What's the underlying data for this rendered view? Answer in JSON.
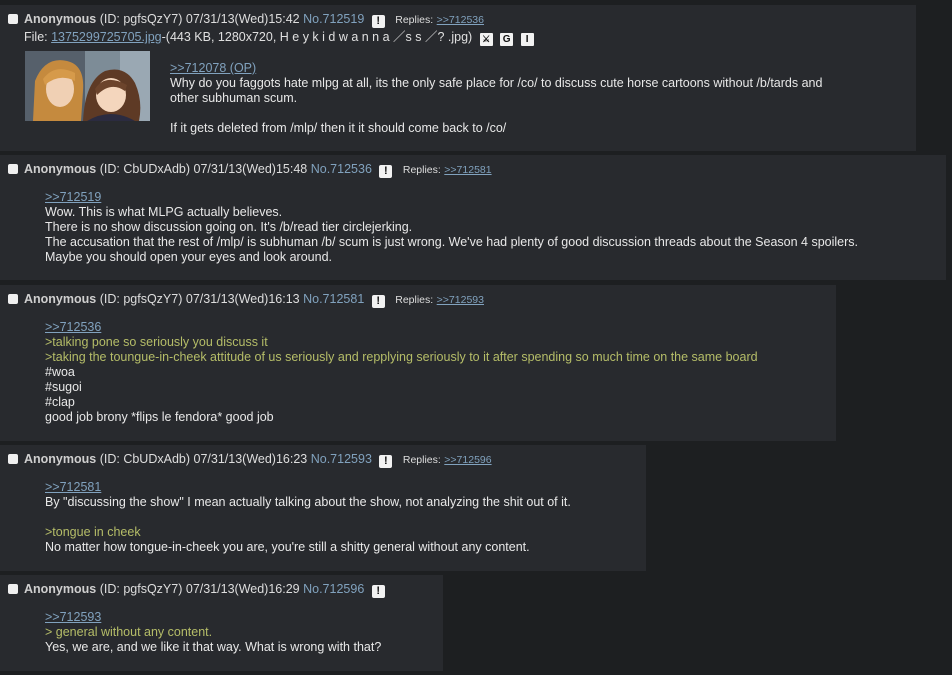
{
  "posts": [
    {
      "name": "Anonymous",
      "id": "(ID: pgfsQzY7)",
      "date": "07/31/13(Wed)15:42",
      "no": "No.712519",
      "replies_label": "Replies:",
      "replies": [
        ">>712536"
      ],
      "file_label": "File:",
      "file_name": "1375299725705.jpg",
      "file_info": "-(443 KB, 1280x720, H e y  k i d  w a n n a ／s s ／? .jpg)",
      "file_icons": [
        "search-icon",
        "google-icon",
        "iqdb-icon"
      ],
      "lines": [
        {
          "quote": ">>712078 (OP)"
        },
        {
          "text": "Why do you faggots hate mlpg at all, its the only safe place for /co/ to discuss cute horse cartoons without /b/tards and"
        },
        {
          "text": "other subhuman scum."
        },
        {
          "text": ""
        },
        {
          "text": "If it gets deleted from /mlp/ then it it should come back to /co/"
        }
      ]
    },
    {
      "name": "Anonymous",
      "id": "(ID: CbUDxAdb)",
      "date": "07/31/13(Wed)15:48",
      "no": "No.712536",
      "replies_label": "Replies:",
      "replies": [
        ">>712581"
      ],
      "lines": [
        {
          "quote": ">>712519"
        },
        {
          "text": "Wow. This is what MLPG actually believes."
        },
        {
          "text": "There is no show discussion going on. It's /b/read tier circlejerking."
        },
        {
          "text": "The accusation that the rest of /mlp/ is subhuman /b/ scum is just wrong. We've had plenty of good discussion threads about the Season 4 spoilers."
        },
        {
          "text": "Maybe you should open your eyes and look around."
        }
      ]
    },
    {
      "name": "Anonymous",
      "id": "(ID: pgfsQzY7)",
      "date": "07/31/13(Wed)16:13",
      "no": "No.712581",
      "replies_label": "Replies:",
      "replies": [
        ">>712593"
      ],
      "lines": [
        {
          "quote": ">>712536"
        },
        {
          "greentext": ">talking pone so seriously you discuss it"
        },
        {
          "greentext": ">taking the toungue-in-cheek attitude of us seriously and repplying seriously to it after spending so much time on the same board"
        },
        {
          "text": "#woa"
        },
        {
          "text": "#sugoi"
        },
        {
          "text": "#clap"
        },
        {
          "text": "good job brony *flips le fendora* good job"
        }
      ]
    },
    {
      "name": "Anonymous",
      "id": "(ID: CbUDxAdb)",
      "date": "07/31/13(Wed)16:23",
      "no": "No.712593",
      "replies_label": "Replies:",
      "replies": [
        ">>712596"
      ],
      "lines": [
        {
          "quote": ">>712581"
        },
        {
          "text": "By \"discussing the show\" I mean actually talking about the show, not analyzing the shit out of it."
        },
        {
          "text": ""
        },
        {
          "greentext": ">tongue in cheek"
        },
        {
          "text": "No matter how tongue-in-cheek you are, you're still a shitty general without any content."
        }
      ]
    },
    {
      "name": "Anonymous",
      "id": "(ID: pgfsQzY7)",
      "date": "07/31/13(Wed)16:29",
      "no": "No.712596",
      "replies_label": "",
      "replies": [],
      "lines": [
        {
          "quote": ">>712593"
        },
        {
          "greentext": "> general without any content."
        },
        {
          "text": "Yes, we are, and we like it that way. What is wrong with that?"
        }
      ]
    }
  ],
  "colors": {
    "background": "#1d1f21",
    "post": "#282a2e",
    "link": "#81a2be",
    "greentext": "#b5bd68"
  }
}
